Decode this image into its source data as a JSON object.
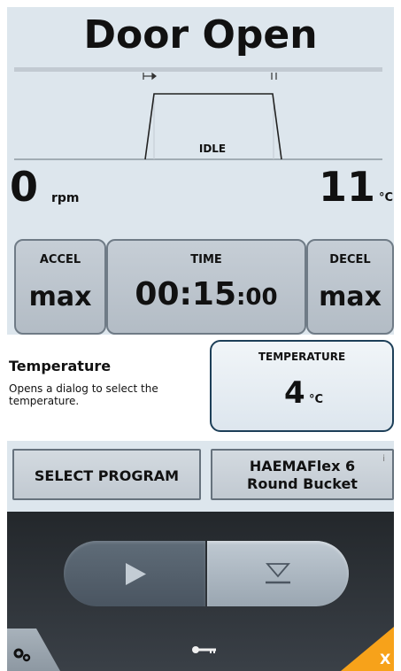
{
  "status": {
    "title": "Door Open",
    "phase": "IDLE"
  },
  "readings": {
    "speed_value": "0",
    "speed_unit": "rpm",
    "temp_value": "11",
    "temp_unit": "°C"
  },
  "params": {
    "accel": {
      "label": "ACCEL",
      "value": "max"
    },
    "time": {
      "label": "TIME",
      "value_main": "00:15",
      "value_sec": ":00"
    },
    "decel": {
      "label": "DECEL",
      "value": "max"
    }
  },
  "info_panel": {
    "title": "Temperature",
    "description": "Opens a dialog to select the temperature.",
    "temperature_button": {
      "label": "TEMPERATURE",
      "value": "4",
      "unit": "°C"
    }
  },
  "program": {
    "select_label": "SELECT PROGRAM",
    "rotor_line1": "HAEMAFlex 6",
    "rotor_line2": "Round Bucket",
    "info_marker": "i"
  },
  "controls": {
    "close_label": "X"
  },
  "icons": [
    "play-icon",
    "stop-icon",
    "settings-gears-icon",
    "key-icon",
    "info-icon"
  ],
  "colors": {
    "accent": "#f7a21a",
    "panel_bg": "#dde6ed",
    "control_bg": "#2e3339",
    "active_border": "#1d3f58"
  }
}
